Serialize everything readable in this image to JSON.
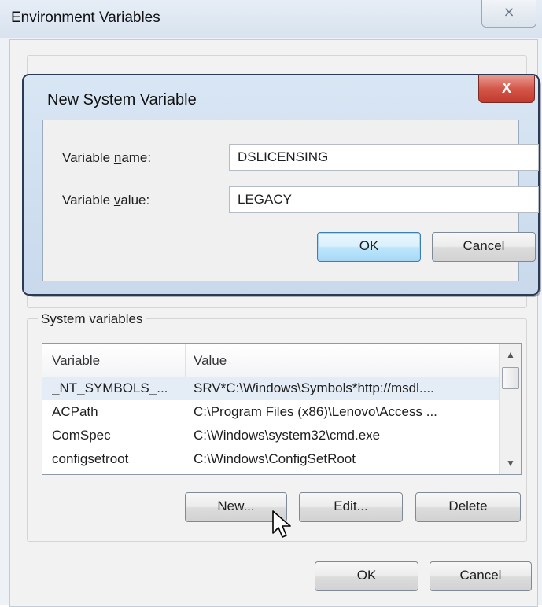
{
  "env_window": {
    "title": "Environment Variables",
    "close_glyph": "⨯",
    "system_group_label": "System variables",
    "columns": {
      "variable": "Variable",
      "value": "Value"
    },
    "rows": [
      {
        "variable": "_NT_SYMBOLS_...",
        "value": "SRV*C:\\Windows\\Symbols*http://msdl...."
      },
      {
        "variable": "ACPath",
        "value": "C:\\Program Files (x86)\\Lenovo\\Access ..."
      },
      {
        "variable": "ComSpec",
        "value": "C:\\Windows\\system32\\cmd.exe"
      },
      {
        "variable": "configsetroot",
        "value": "C:\\Windows\\ConfigSetRoot"
      }
    ],
    "buttons": {
      "new": "New...",
      "edit": "Edit...",
      "delete": "Delete",
      "ok": "OK",
      "cancel": "Cancel"
    }
  },
  "dialog": {
    "title": "New System Variable",
    "close_glyph": "X",
    "name_label_pre": "Variable ",
    "name_label_underline": "n",
    "name_label_post": "ame:",
    "value_label_pre": "Variable ",
    "value_label_underline": "v",
    "value_label_post": "alue:",
    "name_value": "DSLICENSING",
    "value_value": "LEGACY",
    "ok": "OK",
    "cancel": "Cancel"
  },
  "icons": {
    "scroll_up": "▲",
    "scroll_down": "▼",
    "cursor": "mouse-pointer-icon"
  }
}
